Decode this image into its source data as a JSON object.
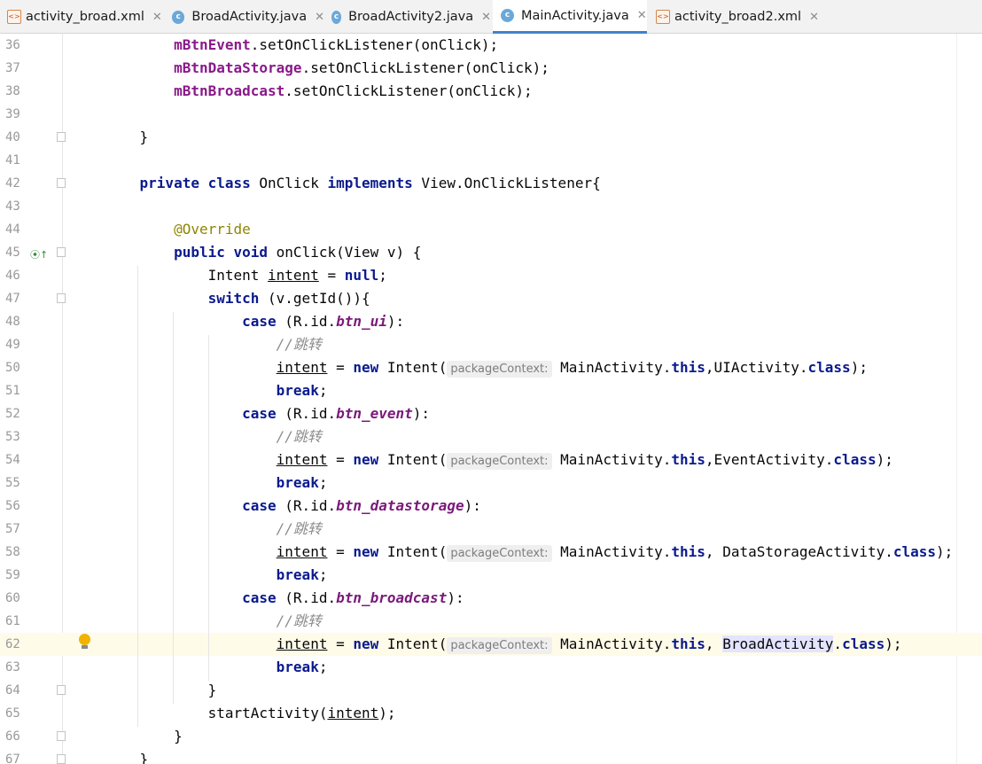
{
  "tabs": [
    {
      "label": "activity_broad.xml",
      "icon": "xml-file-icon"
    },
    {
      "label": "BroadActivity.java",
      "icon": "class-icon"
    },
    {
      "label": "BroadActivity2.java",
      "icon": "class-icon"
    },
    {
      "label": "MainActivity.java",
      "icon": "class-icon",
      "active": true
    },
    {
      "label": "activity_broad2.xml",
      "icon": "xml-file-icon"
    }
  ],
  "tab_close_glyph": "✕",
  "icon_text": {
    "xml": "<>",
    "class": "c"
  },
  "colors": {
    "keyword": "#0a1a8e",
    "field": "#8a1a8a",
    "comment": "#8c8c8c",
    "annotation": "#8f8500",
    "active_tab_underline": "#4083c9",
    "current_line": "#fefbe9"
  },
  "current_line": 62,
  "lines": [
    {
      "n": 36,
      "t": [
        [
          "        ",
          ""
        ],
        [
          "mBtnEvent",
          "fld"
        ],
        [
          ".setOnClickListener(onClick);",
          ""
        ]
      ]
    },
    {
      "n": 37,
      "t": [
        [
          "        ",
          ""
        ],
        [
          "mBtnDataStorage",
          "fld"
        ],
        [
          ".setOnClickListener(onClick);",
          ""
        ]
      ]
    },
    {
      "n": 38,
      "t": [
        [
          "        ",
          ""
        ],
        [
          "mBtnBroadcast",
          "fld"
        ],
        [
          ".setOnClickListener(onClick);",
          ""
        ]
      ]
    },
    {
      "n": 39,
      "t": []
    },
    {
      "n": 40,
      "t": [
        [
          "    }",
          ""
        ]
      ]
    },
    {
      "n": 41,
      "t": []
    },
    {
      "n": 42,
      "t": [
        [
          "    ",
          ""
        ],
        [
          "private class",
          "kw"
        ],
        [
          " OnClick ",
          ""
        ],
        [
          "implements",
          "kw"
        ],
        [
          " View.OnClickListener{",
          ""
        ]
      ]
    },
    {
      "n": 43,
      "t": []
    },
    {
      "n": 44,
      "t": [
        [
          "        ",
          ""
        ],
        [
          "@Override",
          "ann"
        ]
      ]
    },
    {
      "n": 45,
      "t": [
        [
          "        ",
          ""
        ],
        [
          "public void",
          "kw"
        ],
        [
          " onClick(View v) {",
          ""
        ]
      ]
    },
    {
      "n": 46,
      "t": [
        [
          "            Intent ",
          ""
        ],
        [
          "intent",
          "ul"
        ],
        [
          " = ",
          ""
        ],
        [
          "null",
          "kw"
        ],
        [
          ";",
          ""
        ]
      ]
    },
    {
      "n": 47,
      "t": [
        [
          "            ",
          ""
        ],
        [
          "switch",
          "kw"
        ],
        [
          " (v.getId()){",
          ""
        ]
      ]
    },
    {
      "n": 48,
      "t": [
        [
          "                ",
          ""
        ],
        [
          "case",
          "kw"
        ],
        [
          " (R.id.",
          ""
        ],
        [
          "btn_ui",
          "ifld"
        ],
        [
          "):",
          ""
        ]
      ]
    },
    {
      "n": 49,
      "t": [
        [
          "                    ",
          ""
        ],
        [
          "//跳转",
          "cmt"
        ]
      ]
    },
    {
      "n": 50,
      "t": [
        [
          "                    ",
          ""
        ],
        [
          "intent",
          "ul"
        ],
        [
          " = ",
          ""
        ],
        [
          "new",
          "kw"
        ],
        [
          " Intent(",
          ""
        ],
        [
          "packageContext:",
          "hint"
        ],
        [
          " MainActivity.",
          ""
        ],
        [
          "this",
          "kw"
        ],
        [
          ",UIActivity.",
          ""
        ],
        [
          "class",
          "kw"
        ],
        [
          ");",
          ""
        ]
      ]
    },
    {
      "n": 51,
      "t": [
        [
          "                    ",
          ""
        ],
        [
          "break",
          "kw"
        ],
        [
          ";",
          ""
        ]
      ]
    },
    {
      "n": 52,
      "t": [
        [
          "                ",
          ""
        ],
        [
          "case",
          "kw"
        ],
        [
          " (R.id.",
          ""
        ],
        [
          "btn_event",
          "ifld"
        ],
        [
          "):",
          ""
        ]
      ]
    },
    {
      "n": 53,
      "t": [
        [
          "                    ",
          ""
        ],
        [
          "//跳转",
          "cmt"
        ]
      ]
    },
    {
      "n": 54,
      "t": [
        [
          "                    ",
          ""
        ],
        [
          "intent",
          "ul"
        ],
        [
          " = ",
          ""
        ],
        [
          "new",
          "kw"
        ],
        [
          " Intent(",
          ""
        ],
        [
          "packageContext:",
          "hint"
        ],
        [
          " MainActivity.",
          ""
        ],
        [
          "this",
          "kw"
        ],
        [
          ",EventActivity.",
          ""
        ],
        [
          "class",
          "kw"
        ],
        [
          ");",
          ""
        ]
      ]
    },
    {
      "n": 55,
      "t": [
        [
          "                    ",
          ""
        ],
        [
          "break",
          "kw"
        ],
        [
          ";",
          ""
        ]
      ]
    },
    {
      "n": 56,
      "t": [
        [
          "                ",
          ""
        ],
        [
          "case",
          "kw"
        ],
        [
          " (R.id.",
          ""
        ],
        [
          "btn_datastorage",
          "ifld"
        ],
        [
          "):",
          ""
        ]
      ]
    },
    {
      "n": 57,
      "t": [
        [
          "                    ",
          ""
        ],
        [
          "//跳转",
          "cmt"
        ]
      ]
    },
    {
      "n": 58,
      "t": [
        [
          "                    ",
          ""
        ],
        [
          "intent",
          "ul"
        ],
        [
          " = ",
          ""
        ],
        [
          "new",
          "kw"
        ],
        [
          " Intent(",
          ""
        ],
        [
          "packageContext:",
          "hint"
        ],
        [
          " MainActivity.",
          ""
        ],
        [
          "this",
          "kw"
        ],
        [
          ", DataStorageActivity.",
          ""
        ],
        [
          "class",
          "kw"
        ],
        [
          ");",
          ""
        ]
      ]
    },
    {
      "n": 59,
      "t": [
        [
          "                    ",
          ""
        ],
        [
          "break",
          "kw"
        ],
        [
          ";",
          ""
        ]
      ]
    },
    {
      "n": 60,
      "t": [
        [
          "                ",
          ""
        ],
        [
          "case",
          "kw"
        ],
        [
          " (R.id.",
          ""
        ],
        [
          "btn_broadcast",
          "ifld"
        ],
        [
          "):",
          ""
        ]
      ]
    },
    {
      "n": 61,
      "t": [
        [
          "                    ",
          ""
        ],
        [
          "//跳转",
          "cmt"
        ]
      ]
    },
    {
      "n": 62,
      "t": [
        [
          "                    ",
          ""
        ],
        [
          "intent",
          "ul"
        ],
        [
          " = ",
          ""
        ],
        [
          "new",
          "kw"
        ],
        [
          " Intent(",
          ""
        ],
        [
          "packageContext:",
          "hint"
        ],
        [
          " MainActivity.",
          ""
        ],
        [
          "this",
          "kw"
        ],
        [
          ", ",
          ""
        ],
        [
          "BroadActivity",
          "hl"
        ],
        [
          ".",
          ""
        ],
        [
          "class",
          "kw"
        ],
        [
          ");",
          ""
        ]
      ]
    },
    {
      "n": 63,
      "t": [
        [
          "                    ",
          ""
        ],
        [
          "break",
          "kw"
        ],
        [
          ";",
          ""
        ]
      ]
    },
    {
      "n": 64,
      "t": [
        [
          "            }",
          ""
        ]
      ]
    },
    {
      "n": 65,
      "t": [
        [
          "            startActivity(",
          ""
        ],
        [
          "intent",
          "ul"
        ],
        [
          ");",
          ""
        ]
      ]
    },
    {
      "n": 66,
      "t": [
        [
          "        }",
          ""
        ]
      ]
    },
    {
      "n": 67,
      "t": [
        [
          "    }",
          ""
        ]
      ]
    }
  ]
}
